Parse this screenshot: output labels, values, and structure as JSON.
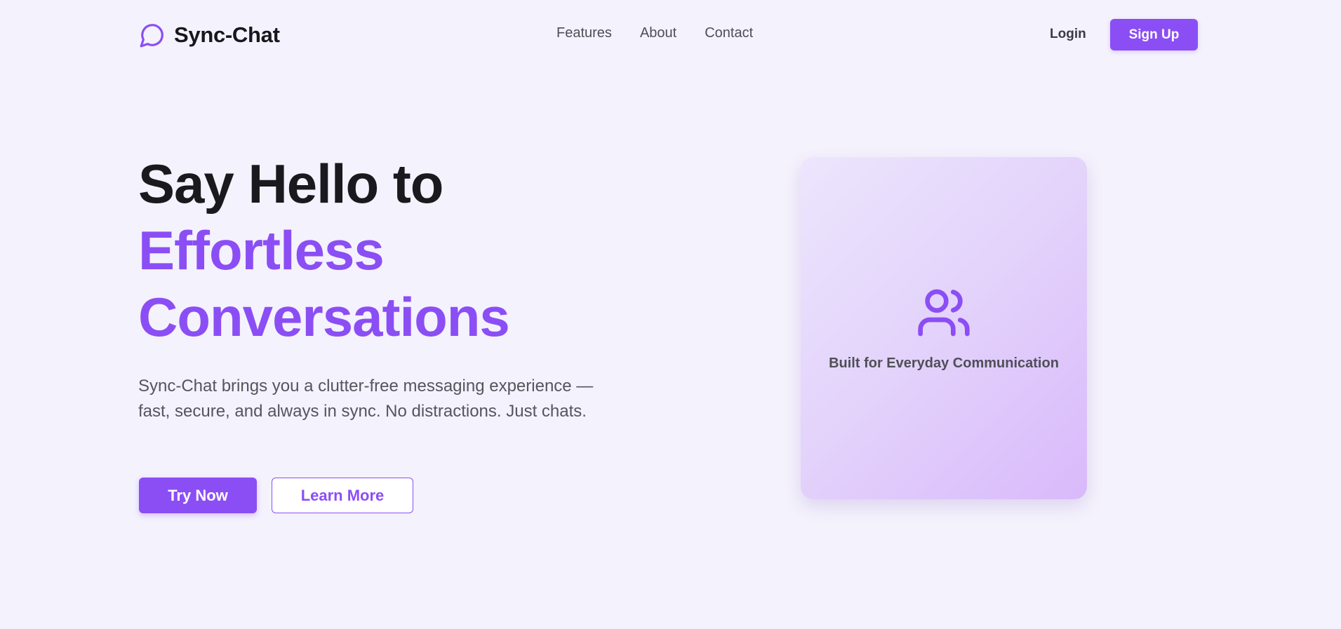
{
  "header": {
    "brand_name": "Sync-Chat",
    "brand_icon": "chat-bubble-icon",
    "nav": [
      {
        "label": "Features"
      },
      {
        "label": "About"
      },
      {
        "label": "Contact"
      }
    ],
    "login_label": "Login",
    "signup_label": "Sign Up"
  },
  "hero": {
    "title_line1": "Say Hello to",
    "title_line2": "Effortless",
    "title_line3": "Conversations",
    "description": "Sync-Chat brings you a clutter-free messaging experience — fast, secure, and always in sync. No distractions. Just chats.",
    "try_label": "Try Now",
    "learn_label": "Learn More"
  },
  "card": {
    "icon": "users-icon",
    "caption": "Built for Everyday Communication"
  },
  "colors": {
    "accent": "#8b4ef5",
    "background": "#f4f2fc",
    "card_gradient_start": "#ece6fd",
    "card_gradient_end": "#d9b9fb"
  }
}
